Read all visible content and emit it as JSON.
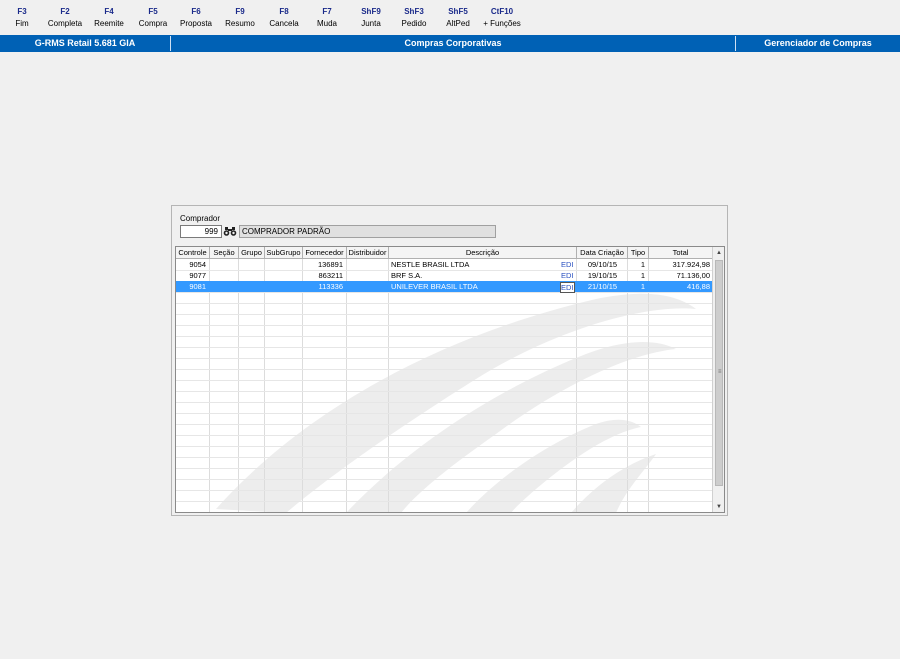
{
  "toolbar": {
    "keys": [
      {
        "key": "F3",
        "label": "Fim"
      },
      {
        "key": "F2",
        "label": "Completa"
      },
      {
        "key": "F4",
        "label": "Reemite"
      },
      {
        "key": "F5",
        "label": "Compra"
      },
      {
        "key": "F6",
        "label": "Proposta"
      },
      {
        "key": "F9",
        "label": "Resumo"
      },
      {
        "key": "F8",
        "label": "Cancela"
      },
      {
        "key": "F7",
        "label": "Muda"
      },
      {
        "key": "ShF9",
        "label": "Junta"
      },
      {
        "key": "ShF3",
        "label": "Pedido"
      },
      {
        "key": "ShF5",
        "label": "AltPed"
      },
      {
        "key": "CtF10",
        "label": "+ Funções"
      }
    ]
  },
  "titlebar": {
    "app": "G-RMS Retail 5.681 GIA",
    "screen": "Compras Corporativas",
    "module": "Gerenciador de Compras",
    "color": "#0061b5"
  },
  "comprador": {
    "label": "Comprador",
    "code": "999",
    "name": "COMPRADOR PADRÃO",
    "search_icon": "binoculars-icon"
  },
  "grid": {
    "columns": [
      "Controle",
      "Seção",
      "Grupo",
      "SubGrupo",
      "Fornecedor",
      "Distribuidor",
      "Descrição",
      "Data Criação",
      "Tipo",
      "Total"
    ],
    "rows": [
      {
        "controle": "9054",
        "secao": "",
        "grupo": "",
        "subgrupo": "",
        "fornecedor": "136891",
        "distribuidor": "",
        "descricao": "NESTLE BRASIL LTDA",
        "edi": "EDI",
        "data": "09/10/15",
        "tipo": "1",
        "total": "317.924,98"
      },
      {
        "controle": "9077",
        "secao": "",
        "grupo": "",
        "subgrupo": "",
        "fornecedor": "863211",
        "distribuidor": "",
        "descricao": "BRF S.A.",
        "edi": "EDI",
        "data": "19/10/15",
        "tipo": "1",
        "total": "71.136,00"
      },
      {
        "controle": "9081",
        "secao": "",
        "grupo": "",
        "subgrupo": "",
        "fornecedor": "113336",
        "distribuidor": "",
        "descricao": "UNILEVER BRASIL LTDA",
        "edi": "EDI",
        "data": "21/10/15",
        "tipo": "1",
        "total": "416,88"
      }
    ],
    "selected_row": 2,
    "selection_color": "#3399ff"
  }
}
